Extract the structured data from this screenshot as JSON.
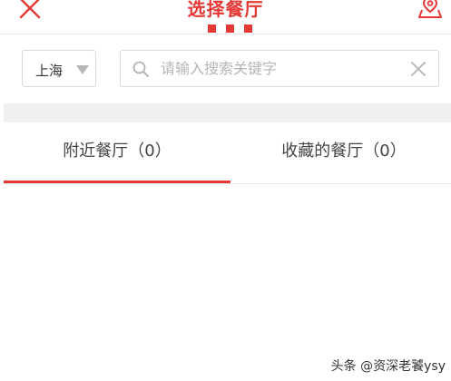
{
  "header": {
    "title": "选择餐厅",
    "close_icon": "close-icon",
    "map_icon": "map-location-icon",
    "accent_color": "#e53935"
  },
  "search": {
    "city": "上海",
    "placeholder": "请输入搜索关键字",
    "value": ""
  },
  "tabs": [
    {
      "label": "附近餐厅（0）",
      "active": true
    },
    {
      "label": "收藏的餐厅（0）",
      "active": false
    }
  ],
  "watermark": "头条 @资深老饕ysy"
}
